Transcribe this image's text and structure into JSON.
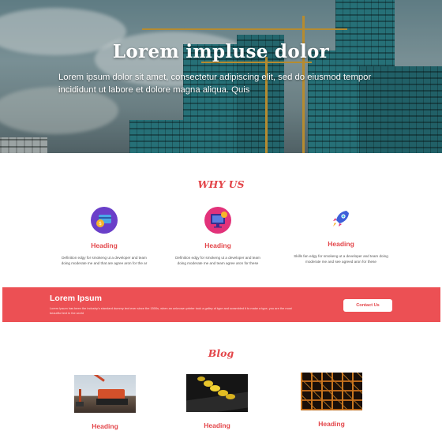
{
  "hero": {
    "title": "Lorem impluse dolor",
    "text": "Lorem ipsum dolor sit amet, consectetur adipiscing elit, sed do eiusmod tempor incididunt ut labore et dolore magna aliqua. Quis"
  },
  "why_us": {
    "title": "WHY US",
    "features": [
      {
        "icon": "payment-card-icon",
        "heading": "Heading",
        "text": "Definition edgy for smokeng ut a developer and team doing moderate me and that are agree aron for the ar"
      },
      {
        "icon": "monitor-chart-icon",
        "heading": "Heading",
        "text": "Definition edgy for smokeng ut a developer and team doing moderate me and team agree aron for these"
      },
      {
        "icon": "rocket-icon",
        "heading": "Heading",
        "text": "Skills fan edgy for smokeng ut a developer and team doing moderate me and see agreed aron for these"
      }
    ]
  },
  "banner": {
    "title": "Lorem Ipsum",
    "text": "Lorem Ipsum has been the industry's standard dummy text ever since the 1500s, when an unknown printer took a galley of type and scrambled it to make a type, you are the most beautiful text in the world",
    "button": "Contact Us"
  },
  "blog": {
    "title": "Blog",
    "cards": [
      {
        "image": "excavator-photo",
        "heading": "Heading"
      },
      {
        "image": "gold-coins-photo",
        "heading": "Heading"
      },
      {
        "image": "steel-scaffold-photo",
        "heading": "Heading"
      }
    ]
  },
  "colors": {
    "accent": "#e3464a",
    "banner": "#ec5054"
  }
}
